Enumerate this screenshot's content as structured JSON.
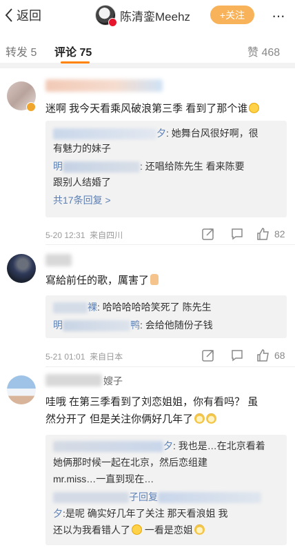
{
  "header": {
    "back_label": "返回",
    "username": "陈清銮Meehz",
    "follow_label": "+关注",
    "more_label": "···"
  },
  "tabs": {
    "repost": "转发 5",
    "comments": "评论 75",
    "likes": "赞 468"
  },
  "colors": {
    "accent": "#ff8200",
    "follow_button": "#f8b35a",
    "link": "#5b7fb4"
  },
  "comments": [
    {
      "text": "迷啊 我今天看乘风破浪第三季 看到了那个谁",
      "emoji": "cry-laugh",
      "replies": [
        {
          "name_suffix": "夕",
          "text": ": 她舞台风很好啊，很"
        },
        {
          "text": "有魅力的妹子"
        },
        {
          "name_prefix": "明",
          "text": ": 还唱给陈先生 看来陈要"
        },
        {
          "text": "跟别人结婚了"
        }
      ],
      "more_replies": "共17条回复 >",
      "time": "5-20 12:31",
      "source": "来自四川",
      "likes": "82"
    },
    {
      "text": "寫給前任的歌，厲害了",
      "emoji": "thumbs-up",
      "replies": [
        {
          "name_suffix": "裸",
          "text": ": 哈哈哈哈哈笑死了 陈先生"
        },
        {
          "name_prefix": "明",
          "name_suffix": "鸭",
          "text": ": 会给他随份子钱"
        }
      ],
      "time": "5-21 01:01",
      "source": "来自日本",
      "likes": "68"
    },
    {
      "name_suffix": "嫂子",
      "text_line1": "哇哦 在第三季看到了刘恋姐姐，你有看吗？ 虽",
      "text_line2": "然分开了 但是关注你俩好几年了",
      "emoji": "cat-face",
      "replies": [
        {
          "name_suffix": "夕",
          "text": ": 我也是…在北京看着"
        },
        {
          "text": "她俩那时候一起在北京，然后恋组建"
        },
        {
          "text": "mr.miss…一直到现在…"
        },
        {
          "name_suffix": "子回复",
          "text": ""
        },
        {
          "name_suffix": "夕",
          "text": ":是呢 确实好几年了关注 那天看浪姐 我"
        },
        {
          "text": "还以为我看错人了",
          "tail": " 一看是恋姐"
        }
      ]
    }
  ]
}
